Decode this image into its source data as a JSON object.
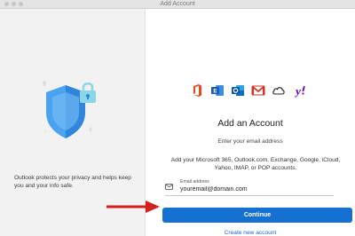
{
  "window": {
    "title": "Add Account"
  },
  "left_panel": {
    "privacy_text": "Outlook protects your privacy and helps keep you and your info safe."
  },
  "providers": [
    {
      "icon": "office-icon",
      "color": "#e64a19"
    },
    {
      "icon": "exchange-icon",
      "color": "#1f5aa8"
    },
    {
      "icon": "outlook-icon",
      "color": "#1f78d1"
    },
    {
      "icon": "gmail-icon",
      "color": "#d93025"
    },
    {
      "icon": "icloud-icon",
      "color": "#222222"
    },
    {
      "icon": "yahoo-icon",
      "color": "#6001d2"
    }
  ],
  "main": {
    "heading": "Add an Account",
    "subheading": "Enter your email address",
    "description": "Add your Microsoft 365, Outlook.com, Exchange, Google, iCloud, Yahoo, IMAP, or POP accounts.",
    "email_label": "Email address",
    "email_value": "youremail@domain.com",
    "continue_label": "Continue",
    "create_link": "Create new account"
  },
  "colors": {
    "accent": "#1470d1",
    "arrow": "#d51f1f",
    "left_bg": "#f2f2f2"
  }
}
